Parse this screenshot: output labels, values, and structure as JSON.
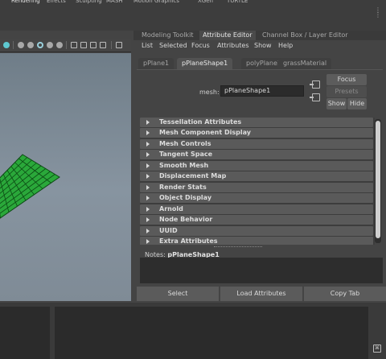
{
  "shelf": {
    "tabs": [
      "Rendering",
      "Effects",
      "Sculpting",
      "MASH",
      "Motion Graphics",
      "XGen",
      "TURTLE"
    ]
  },
  "viewport": {
    "grid_color": "#2aa83a",
    "grid_line_color": "#0c4a14"
  },
  "panel": {
    "tabs": [
      {
        "label": "Modeling Toolkit",
        "active": false
      },
      {
        "label": "Attribute Editor",
        "active": true
      },
      {
        "label": "Channel Box / Layer Editor",
        "active": false
      }
    ],
    "menu": [
      "List",
      "Selected",
      "Focus",
      "Attributes",
      "Show",
      "Help"
    ],
    "node_tabs": [
      {
        "label": "pPlane1",
        "active": false
      },
      {
        "label": "pPlaneShape1",
        "active": true
      },
      {
        "label": "polyPlane1",
        "active": false
      },
      {
        "label": "grassMaterial",
        "active": false
      }
    ],
    "mesh_label": "mesh:",
    "mesh_value": "pPlaneShape1",
    "focus_label": "Focus",
    "presets_label": "Presets",
    "show_label": "Show",
    "hide_label": "Hide",
    "sections": [
      "Tessellation Attributes",
      "Mesh Component Display",
      "Mesh Controls",
      "Tangent Space",
      "Smooth Mesh",
      "Displacement Map",
      "Render Stats",
      "Object Display",
      "Arnold",
      "Node Behavior",
      "UUID",
      "Extra Attributes"
    ],
    "notes_label": "Notes:",
    "notes_node": "pPlaneShape1",
    "buttons": {
      "select": "Select",
      "load_attributes": "Load Attributes",
      "copy_tab": "Copy Tab"
    }
  }
}
